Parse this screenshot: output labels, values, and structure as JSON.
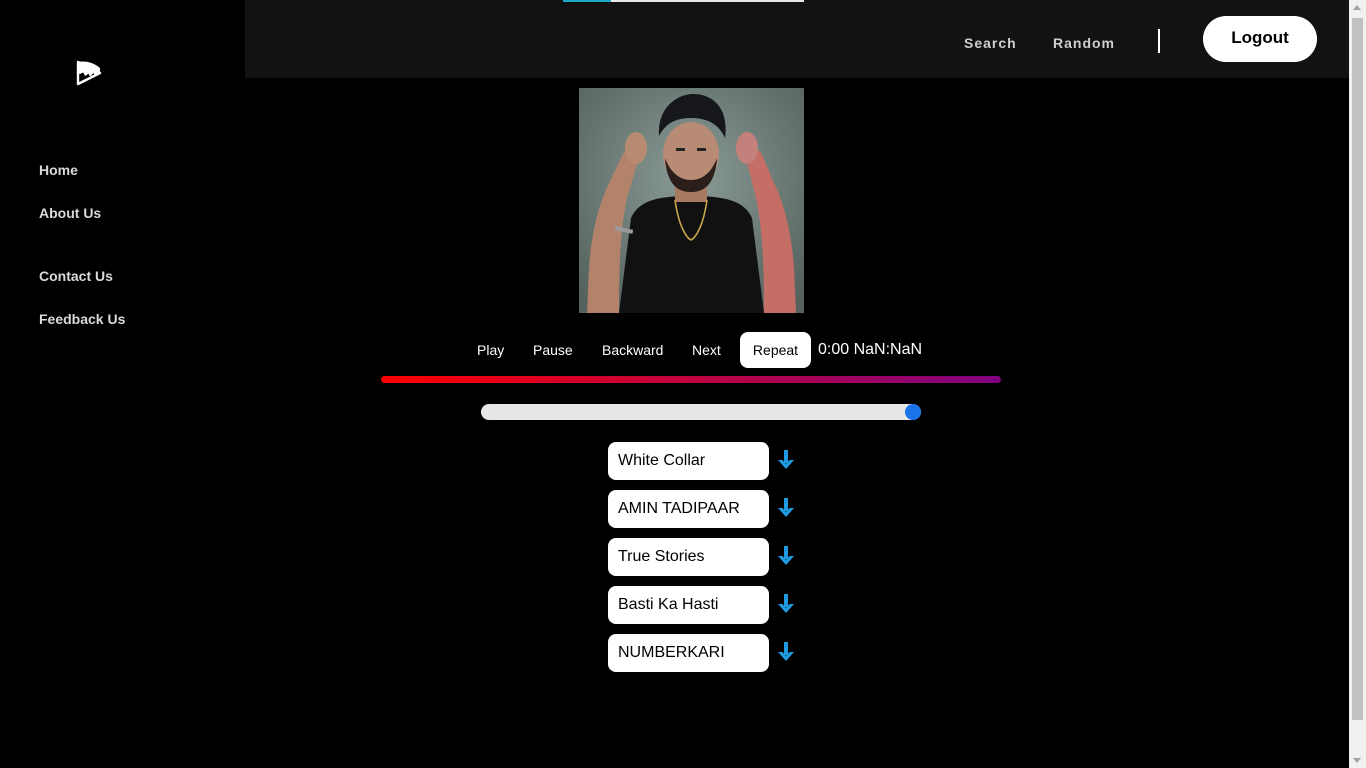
{
  "sidebar": {
    "items": [
      {
        "label": "Home",
        "name": "sidebar-item-home"
      },
      {
        "label": "About Us",
        "name": "sidebar-item-about-us"
      },
      {
        "label": "Contact Us",
        "name": "sidebar-item-contact-us"
      },
      {
        "label": "Feedback Us",
        "name": "sidebar-item-feedback-us"
      }
    ]
  },
  "header": {
    "search_label": "Search",
    "random_label": "Random",
    "logout_label": "Logout"
  },
  "player": {
    "controls": {
      "play": "Play",
      "pause": "Pause",
      "backward": "Backward",
      "next": "Next",
      "repeat": "Repeat"
    },
    "time_display": "0:00 NaN:NaN",
    "volume_fraction": 1.0
  },
  "songs": [
    {
      "title": "White Collar"
    },
    {
      "title": "AMIN TADIPAAR"
    },
    {
      "title": "True Stories"
    },
    {
      "title": "Basti Ka Hasti"
    },
    {
      "title": "NUMBERKARI"
    }
  ],
  "icons": {
    "logo": "music-play-logo-icon",
    "download": "download-arrow-icon"
  },
  "colors": {
    "progress_start": "#ff0000",
    "progress_end": "#800080",
    "volume_thumb": "#1a73e8",
    "download_icon": "#1e9be0",
    "loading_bar": "#17a9c8"
  }
}
